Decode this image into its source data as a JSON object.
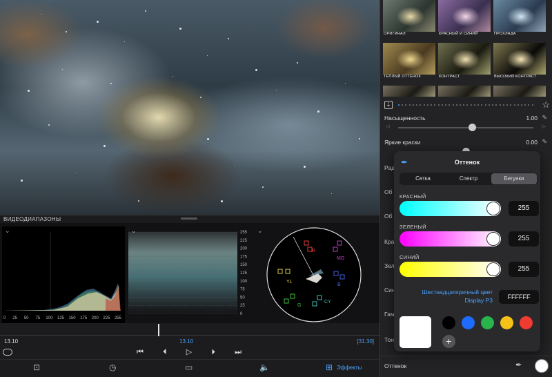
{
  "scopes": {
    "title": "ВИДЕОДИАПАЗОНЫ",
    "histogram_ticks": [
      "0",
      "25",
      "50",
      "75",
      "100",
      "125",
      "150",
      "175",
      "200",
      "225",
      "255"
    ],
    "waveform_ticks": [
      "255",
      "225",
      "200",
      "175",
      "150",
      "125",
      "100",
      "75",
      "50",
      "25",
      "0"
    ],
    "vectorscope_labels": {
      "r": "R",
      "mg": "MG",
      "b": "B",
      "cy": "CY",
      "g": "G",
      "yl": "YL"
    }
  },
  "timeline": {
    "start": "13.10",
    "current": "13.10",
    "end": "[31.30]"
  },
  "toolbar": {
    "effects_label": "Эффекты"
  },
  "presets": [
    {
      "label": "ОРИГИНАЛ"
    },
    {
      "label": "КРАСНЫЙ И СИНИЙ"
    },
    {
      "label": "ПРОХЛАДА"
    },
    {
      "label": "ТЕПЛЫЙ ОТТЕНОК"
    },
    {
      "label": "КОНТРАСТ"
    },
    {
      "label": "ВЫСОКИЙ КОНТРАСТ"
    }
  ],
  "params": {
    "saturation": {
      "label": "Насыщенность",
      "value": "1.00",
      "level": 0.55
    },
    "vibrance": {
      "label": "Яркие краски",
      "value": "0.00",
      "level": 0.5
    }
  },
  "cut_labels": [
    "Рад",
    "Об",
    "Об",
    "Кра",
    "Зел",
    "Син",
    "Гам",
    "Тон"
  ],
  "bottom": {
    "label": "Оттенок"
  },
  "picker": {
    "title": "Оттенок",
    "tabs": [
      "Сетка",
      "Спектр",
      "Бегунки"
    ],
    "active_tab": "Бегунки",
    "channels": [
      {
        "label": "КРАСНЫЙ",
        "value": "255"
      },
      {
        "label": "ЗЕЛЕНЫЙ",
        "value": "255"
      },
      {
        "label": "СИНИЙ",
        "value": "255"
      }
    ],
    "hex_label_line1": "Шестнадцатеричный цвет",
    "hex_label_line2": "Display P3",
    "hex_value": "FFFFFF",
    "current_color": "#FFFFFF",
    "swatches": [
      "#000000",
      "#1E6BFF",
      "#28B34B",
      "#F5C21A",
      "#F03B32"
    ]
  }
}
